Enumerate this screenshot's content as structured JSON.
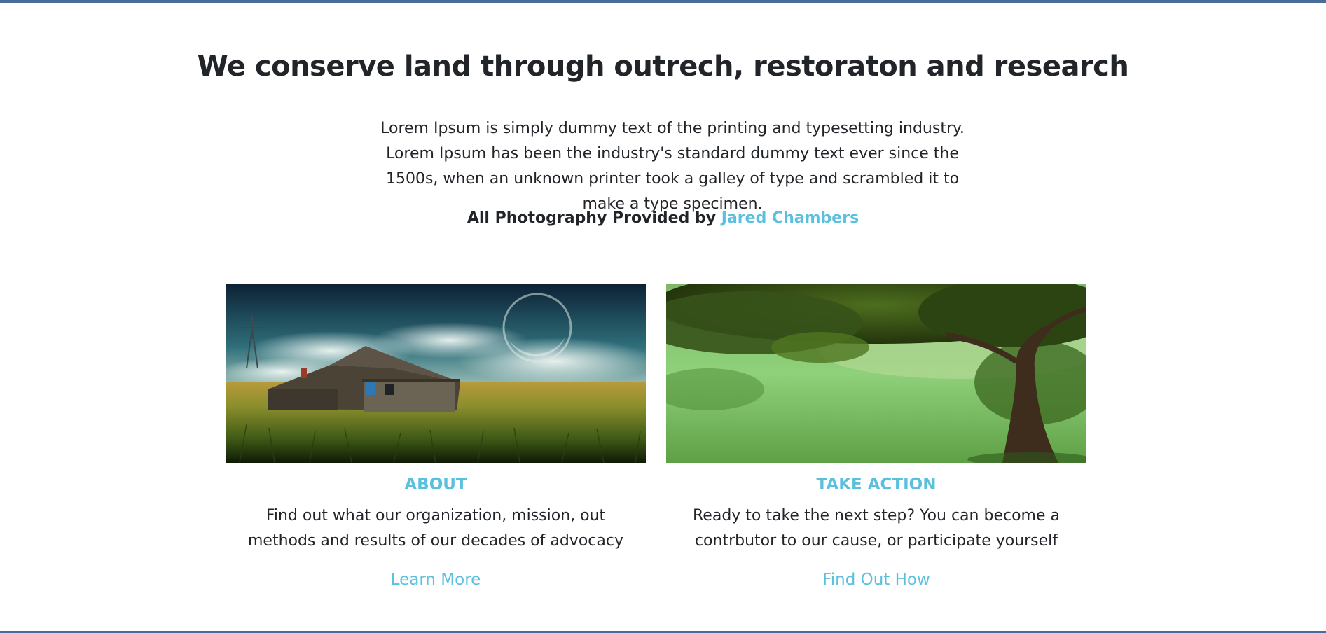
{
  "hero": {
    "headline": "We conserve land through outrech, restoraton and research",
    "intro": "Lorem Ipsum is simply dummy text of the printing and typesetting industry. Lorem Ipsum has been the industry's standard dummy text ever since the 1500s, when an unknown printer took a galley of type and scrambled it to make a type specimen.",
    "credit_prefix": "All Photography Provided by ",
    "credit_name": "Jared Chambers"
  },
  "cards": [
    {
      "image": "farmhouse-field-moon-photo",
      "title": "ABOUT",
      "text": "Find out what our organization, mission, out methods and results of our decades of advocacy",
      "link": "Learn More"
    },
    {
      "image": "tree-meadow-photo",
      "title": "TAKE ACTION",
      "text": "Ready to take the next step? You can become a contrbutor to our cause, or participate yourself",
      "link": "Find Out How"
    }
  ],
  "colors": {
    "accent": "#5bc0de",
    "border": "#4a6d97",
    "text": "#212529"
  }
}
